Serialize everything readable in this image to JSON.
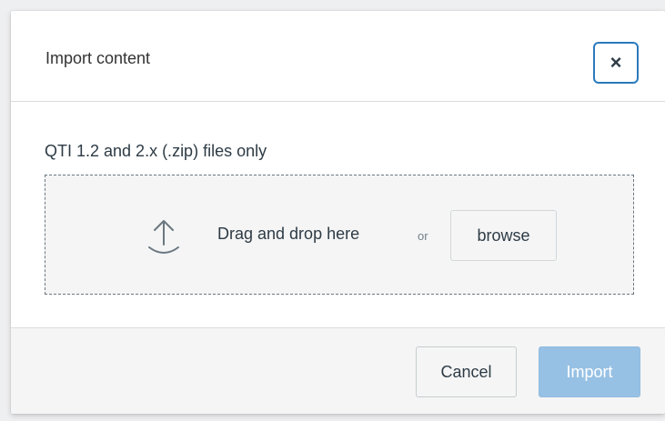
{
  "dialog": {
    "title": "Import content",
    "close_label": "×"
  },
  "body": {
    "note": "QTI 1.2 and 2.x (.zip) files only",
    "dropzone": {
      "drag_text": "Drag and drop here",
      "or_text": "or",
      "browse_label": "browse",
      "icon": "upload-icon"
    }
  },
  "footer": {
    "cancel_label": "Cancel",
    "import_label": "Import"
  },
  "colors": {
    "focus_ring": "#2b7abc",
    "primary_disabled": "#97c1e4",
    "text": "#2d3b45"
  }
}
